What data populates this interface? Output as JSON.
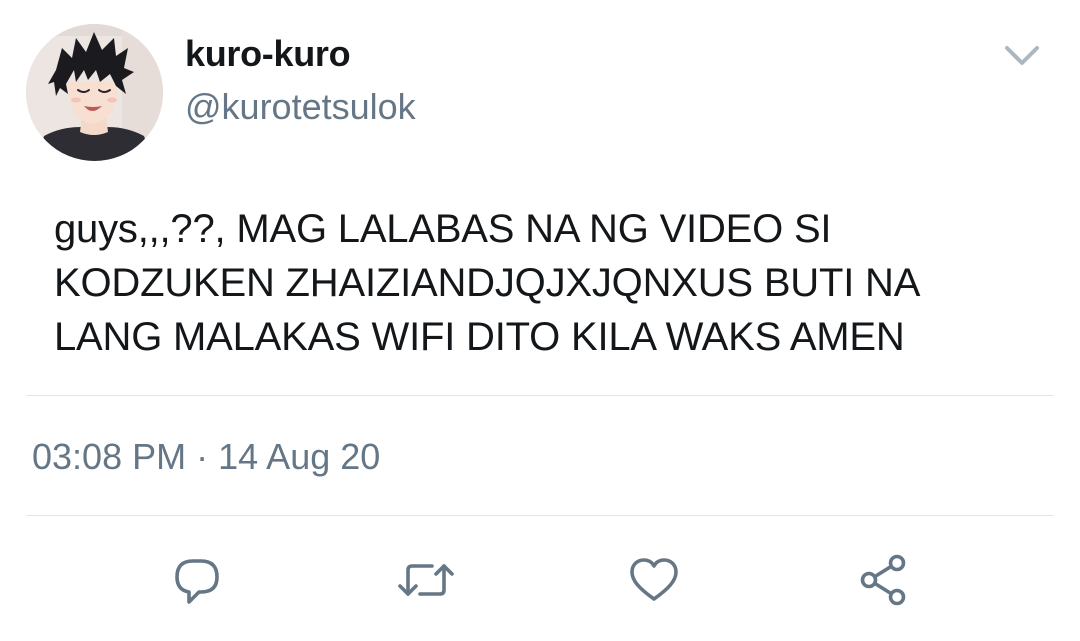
{
  "author": {
    "display_name": "kuro-kuro",
    "handle": "@kurotetsulok"
  },
  "tweet": {
    "text": "guys,,,??, MAG LALABAS NA NG VIDEO SI\nKODZUKEN ZHAIZIANDJQJXJQNXUS BUTI NA\nLANG MALAKAS WIFI DITO KILA WAKS AMEN",
    "time": "03:08 PM",
    "separator": "·",
    "date": "14 Aug 20"
  },
  "icons": {
    "menu": "chevron-down-icon",
    "reply": "speech-bubble-icon",
    "retweet": "retweet-icon",
    "like": "heart-icon",
    "share": "share-icon"
  },
  "colors": {
    "text": "#14171a",
    "secondary": "#657786",
    "divider": "#e1e8ed",
    "icon": "#657786"
  }
}
